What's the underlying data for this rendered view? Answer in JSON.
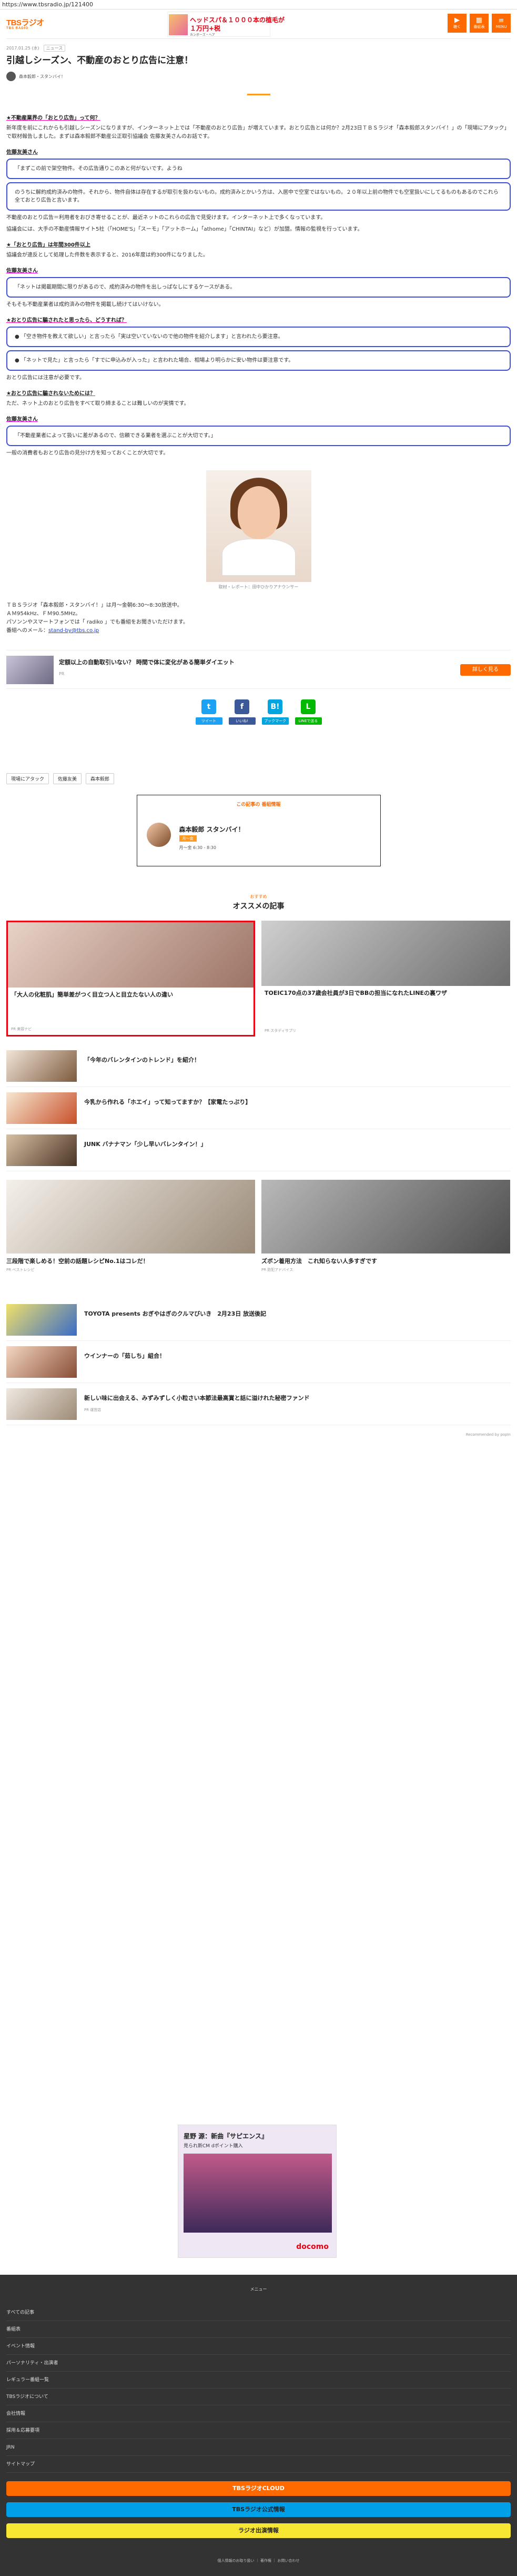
{
  "browser": {
    "url": "https://www.tbsradio.jp/121400"
  },
  "header": {
    "logo": "TBSラジオ",
    "logo_sub": "TBS RADIO",
    "banner": {
      "line1": "ヘッドスパ＆１０００本の植毛が",
      "line2": "１万円+税",
      "line3": "カンボーズ・ヘア"
    },
    "icons": [
      {
        "name": "radiko-icon",
        "label": "聴く",
        "glyph": "▶"
      },
      {
        "name": "program-icon",
        "label": "番組表",
        "glyph": "▦"
      },
      {
        "name": "menu-icon",
        "label": "MENU",
        "glyph": "≡"
      }
    ]
  },
  "article": {
    "date": "2017.01.25 (水)",
    "category": "ニュース",
    "title": "引越しシーズン、不動産のおとり広告に注意！",
    "author": "森本毅郎・スタンバイ！",
    "blocks": [
      {
        "type": "sec",
        "text": "★不動産業界の「おとり広告」って何？"
      },
      {
        "type": "p",
        "text": "新年度を前にこれからも引越しシーズンになりますが、インターネット上では「不動産のおとり広告」が増えています。おとり広告とは何か？2月23日ＴＢＳラジオ「森本毅郎スタンバイ！」の「現場にアタック」で取材報告しました。まずは森本毅郎不動産公正取引協議会 佐藤友美さんのお話です。"
      },
      {
        "type": "spk",
        "text": "佐藤友美さん"
      },
      {
        "type": "q",
        "text": "「まずこの前で架空物件。その広告通りこのあと何がないです。ようね"
      },
      {
        "type": "q2",
        "text": "のうちに解約成約済みの物件。それから、物件自体は存在するが取引を扱わないもの。成約済みとかいう方は、入居中で空室ではないもの。２０年以上前の物件でも空室扱いにしてるものもあるのでこれら全ておとり広告と言います。"
      },
      {
        "type": "p",
        "text": "不動産のおとり広告＝利用者をおびき寄せることが、最近ネットのこれらの広告で見受けます。インターネット上で多くなっています。"
      },
      {
        "type": "p",
        "text": "協議会には、大手の不動産情報サイト5社（「HOME'S」「スーモ」「アットホーム」「athome」「CHINTAI」など）が加盟。情報の監視を行っています。"
      },
      {
        "type": "sec",
        "text": "★「おとり広告」は年間300件以上"
      },
      {
        "type": "p",
        "text": "協議会が違反として処理した件数を表示すると、2016年度は約300件になりました。"
      },
      {
        "type": "spk",
        "text": "佐藤友美さん"
      },
      {
        "type": "q",
        "text": "「ネットは掲載期間に限りがあるので、成約済みの物件を出しっぱなしにするケースがある。"
      },
      {
        "type": "p",
        "text": "そもそも不動産業者は成約済みの物件を掲載し続けてはいけない。"
      },
      {
        "type": "sec",
        "text": "★おとり広告に騙されたと思ったら、どうすれば？"
      },
      {
        "type": "q3",
        "text": "● 「空き物件を教えて欲しい」と言ったら「実は空いていないので他の物件を紹介します」と言われたら要注意。"
      },
      {
        "type": "q3",
        "text": "● 「ネットで見た」と言ったら「すでに申込みが入った」と言われた場合、相場より明らかに安い物件は要注意です。"
      },
      {
        "type": "p",
        "text": "おとり広告には注意が必要です。"
      },
      {
        "type": "sec",
        "text": "★おとり広告に騙されないためには？"
      },
      {
        "type": "p",
        "text": "ただ、ネット上のおとり広告をすべて取り締まることは難しいのが実情です。"
      },
      {
        "type": "spk",
        "text": "佐藤友美さん"
      },
      {
        "type": "q",
        "text": "「不動産業者によって扱いに差があるので、信頼できる業者を選ぶことが大切です。」"
      },
      {
        "type": "p",
        "text": "一般の消費者もおとり広告の見分け方を知っておくことが大切です。"
      }
    ],
    "photo_caption": "取材・レポート：田中ひかりアナウンサー",
    "info": [
      "ＴＢＳラジオ「森本毅郎・スタンバイ！」は月〜金朝6:30〜8:30放送中。",
      "ＡＭ954kHz、ＦＭ90.5MHz。",
      "パソンンやスマートフォンでは「 radiko 」でも番組をお聞きいただけます。",
      "番組へのメール：",
      "stand-by@tbs.co.jp"
    ],
    "related": {
      "title": "定額以上の自動取引いない？ 時間で体に変化がある簡単ダイエット",
      "sub": "PR",
      "button": "詳しく見る"
    },
    "share": [
      {
        "name": "twitter",
        "glyph": "t",
        "color": "#1da1f2",
        "count": "ツイート"
      },
      {
        "name": "facebook",
        "glyph": "f",
        "color": "#3b5998",
        "count": "いいね!"
      },
      {
        "name": "hatena",
        "glyph": "B!",
        "color": "#00a4de",
        "count": "ブックマーク"
      },
      {
        "name": "line",
        "glyph": "L",
        "color": "#00b900",
        "count": "LINEで送る"
      }
    ],
    "tags": [
      "現場にアタック",
      "佐藤友美",
      "森本毅郎"
    ]
  },
  "program": {
    "label": "この記事の 番組情報",
    "name": "森本毅郎 スタンバイ！",
    "badge": "月〜金",
    "time": "月〜金 6:30 - 8:30"
  },
  "recommend": {
    "small": "おすすめ",
    "big": "オススメの記事",
    "cards": [
      {
        "title": "「大人の化粧肌」簡単差がつく目立つ人と目立たない人の違い",
        "sub": "PR 美容ナビ"
      },
      {
        "title": "TOEIC170点の37歳会社員が3日でBBの担当になれたLINEの裏ワザ",
        "sub": "PR スタディサプリ"
      }
    ],
    "list": [
      {
        "title": "「今年のバレンタインのトレンド」を紹介！",
        "sub": ""
      },
      {
        "title": "今乳から作れる「ホエイ」って知ってますか？【家電たっぷり】",
        "sub": ""
      },
      {
        "title": "JUNK バナナマン「少し早いバレンタイン！」",
        "sub": ""
      }
    ],
    "cards2": [
      {
        "title": "三段階で楽しめる！空前の話題レシピNo.1はコレだ！",
        "sub": "PR ベストレシピ"
      },
      {
        "title": "ズボン着用方法　これ知らない人多すぎです",
        "sub": "PR 防犯アドバイス"
      }
    ],
    "list2": [
      {
        "title": "TOYOTA presents おぎやはぎのクルマびいき　2月23日 放送後記",
        "sub": ""
      },
      {
        "title": "ウインナーの「茹しち」組合！",
        "sub": ""
      },
      {
        "title": "新しい味に出会える、みずみずしく小粒さい本節法最高賞と話に溢けれた秘密ファンド",
        "sub": "PR 運営店"
      }
    ],
    "powered": "Recommended by popIn"
  },
  "breadcrumb": [
    "TBSラジオ",
    "森本毅郎・スタンバイ！",
    "引越しシーズン、不動産の"
  ],
  "ad": {
    "line1": "星野 源：新曲『サピエンス』",
    "line2": "見られ新CM dポイント購入",
    "brand": "docomo"
  },
  "footer": {
    "heading": "メニュー",
    "links": [
      "すべての記事",
      "番組表",
      "イベント情報",
      "パーソナリティ・出演者",
      "レギュラー番組一覧",
      "TBSラジオについて",
      "会社情報",
      "採用＆応募要項",
      "JRN",
      "サイトマップ"
    ],
    "buttons": [
      {
        "label": "TBSラジオCLOUD",
        "color": "#ff6a00",
        "fg": "#fff"
      },
      {
        "label": "TBSラジオ公式情報",
        "color": "#00a0e9",
        "fg": "#222"
      },
      {
        "label": "ラジオ出演情報",
        "color": "#f7e733",
        "fg": "#222"
      }
    ],
    "bottom": "個人情報のお取り扱い ｜ 著作権 ｜ お問い合わせ"
  }
}
